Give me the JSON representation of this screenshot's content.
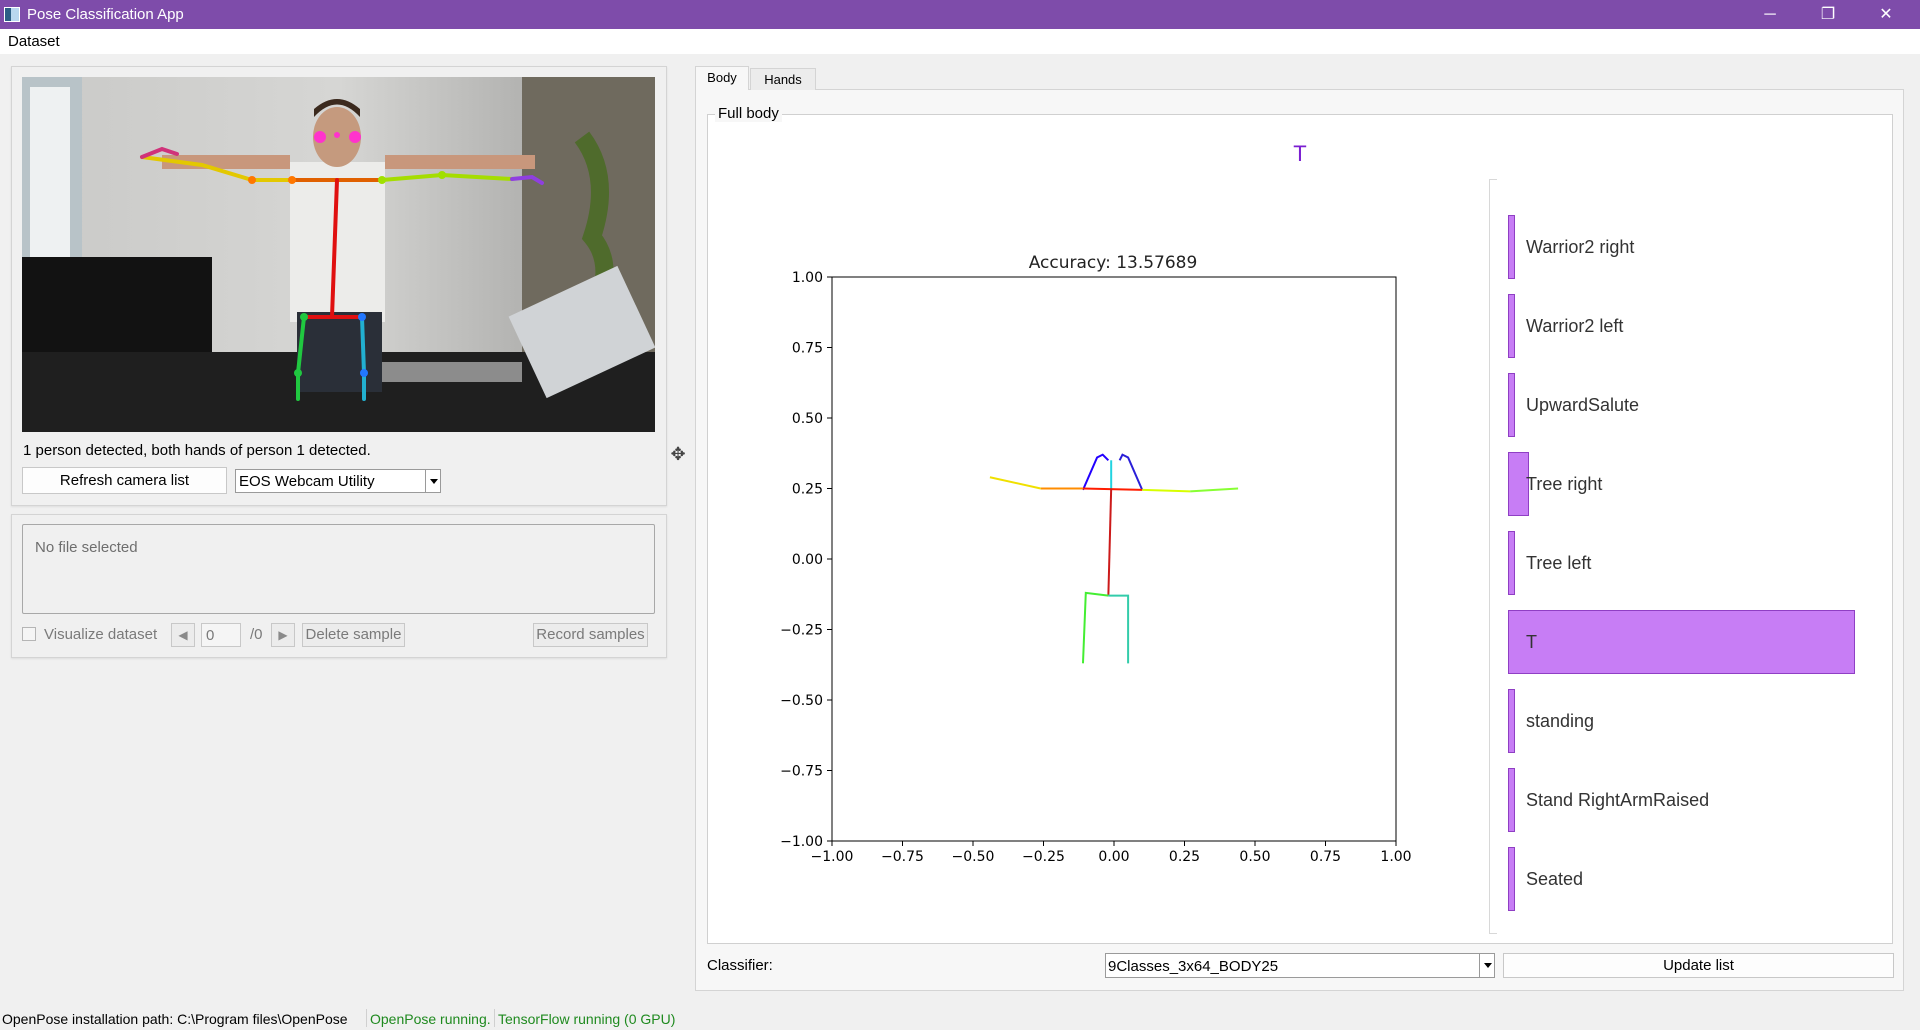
{
  "window": {
    "title": "Pose Classification App",
    "minimize": "─",
    "restore": "❐",
    "close": "✕"
  },
  "menu": {
    "dataset": "Dataset"
  },
  "camera": {
    "status": "1 person detected, both hands of person 1 detected.",
    "refresh_label": "Refresh camera list",
    "selected_camera": "EOS Webcam Utility"
  },
  "dataset_panel": {
    "file_placeholder": "No file selected",
    "visualize_label": "Visualize dataset",
    "sample_index": "0",
    "sample_total": "/0",
    "delete_label": "Delete sample",
    "record_label": "Record samples"
  },
  "tabs": [
    {
      "label": "Body"
    },
    {
      "label": "Hands"
    }
  ],
  "body": {
    "group_title": "Full body",
    "prediction": "T",
    "classifier_label": "Classifier:",
    "classifier_value": "9Classes_3x64_BODY25",
    "update_label": "Update list"
  },
  "classes": [
    {
      "label": "Warrior2 right",
      "prob": 0.02
    },
    {
      "label": "Warrior2 left",
      "prob": 0.02
    },
    {
      "label": "UpwardSalute",
      "prob": 0.02
    },
    {
      "label": "Tree right",
      "prob": 0.06
    },
    {
      "label": "Tree left",
      "prob": 0.02
    },
    {
      "label": "T",
      "prob": 1.0
    },
    {
      "label": "standing",
      "prob": 0.02
    },
    {
      "label": "Stand RightArmRaised",
      "prob": 0.02
    },
    {
      "label": "Seated",
      "prob": 0.02
    }
  ],
  "chart_data": {
    "type": "line",
    "title": "Accuracy: 13.57689",
    "xlim": [
      -1.0,
      1.0
    ],
    "ylim": [
      -1.0,
      1.0
    ],
    "xticks": [
      "−1.00",
      "−0.75",
      "−0.50",
      "−0.25",
      "0.00",
      "0.25",
      "0.50",
      "0.75",
      "1.00"
    ],
    "yticks": [
      "1.00",
      "0.75",
      "0.50",
      "0.25",
      "0.00",
      "−0.25",
      "−0.50",
      "−0.75",
      "−1.00"
    ],
    "grid": false,
    "series": [
      {
        "color": "#2200ff",
        "x": [
          -0.11,
          -0.06,
          -0.04,
          -0.02
        ],
        "y": [
          0.245,
          0.36,
          0.37,
          0.35
        ]
      },
      {
        "color": "#2a1fd8",
        "x": [
          0.02,
          0.03,
          0.05,
          0.1
        ],
        "y": [
          0.35,
          0.37,
          0.36,
          0.245
        ]
      },
      {
        "color": "#22d3e0",
        "x": [
          -0.01,
          -0.01
        ],
        "y": [
          0.35,
          0.25
        ]
      },
      {
        "color": "#ff1c00",
        "x": [
          -0.11,
          0.1
        ],
        "y": [
          0.25,
          0.245
        ]
      },
      {
        "color": "#ff8c00",
        "x": [
          -0.26,
          -0.11
        ],
        "y": [
          0.25,
          0.25
        ]
      },
      {
        "color": "#f0e000",
        "x": [
          -0.44,
          -0.26
        ],
        "y": [
          0.29,
          0.25
        ]
      },
      {
        "color": "#d8ff00",
        "x": [
          0.1,
          0.27
        ],
        "y": [
          0.245,
          0.24
        ]
      },
      {
        "color": "#88ff33",
        "x": [
          0.27,
          0.44
        ],
        "y": [
          0.24,
          0.25
        ]
      },
      {
        "color": "#cc1a1a",
        "x": [
          -0.01,
          -0.02
        ],
        "y": [
          0.25,
          -0.13
        ]
      },
      {
        "color": "#44ee33",
        "x": [
          -0.02,
          -0.1,
          -0.11
        ],
        "y": [
          -0.13,
          -0.12,
          -0.37
        ]
      },
      {
        "color": "#33ccaa",
        "x": [
          -0.02,
          0.05,
          0.05
        ],
        "y": [
          -0.13,
          -0.13,
          -0.37
        ]
      }
    ]
  },
  "statusbar": {
    "path": "OpenPose installation path: C:\\Program files\\OpenPose",
    "openpose": "OpenPose running.",
    "tensorflow": "TensorFlow running (0 GPU)",
    "ok_color": "#1f8a1f"
  }
}
